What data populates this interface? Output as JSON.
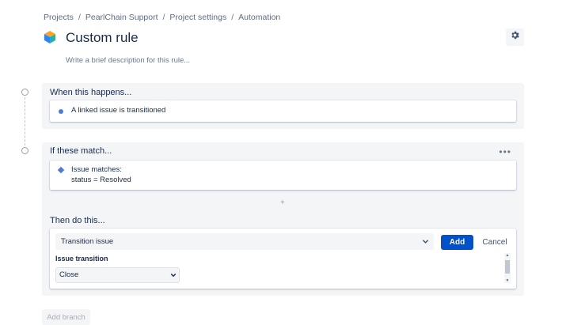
{
  "breadcrumb": [
    "Projects",
    "PearlChain Support",
    "Project settings",
    "Automation"
  ],
  "page": {
    "title": "Custom rule",
    "description_placeholder": "Write a brief description for this rule..."
  },
  "trigger": {
    "title": "When this happens...",
    "item": "A linked issue is transitioned"
  },
  "condition": {
    "title": "If these match...",
    "line1": "Issue matches:",
    "line2": "status = Resolved"
  },
  "action": {
    "title": "Then do this...",
    "selected": "Transition issue",
    "add_label": "Add",
    "cancel_label": "Cancel",
    "field_label": "Issue transition",
    "field_value": "Close"
  },
  "add_branch_label": "Add branch",
  "colors": {
    "accent": "#0052cc",
    "panel": "#f4f5f7",
    "marker": "#4c7bd9"
  }
}
